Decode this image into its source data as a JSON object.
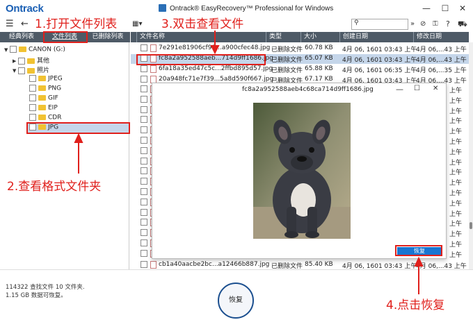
{
  "app": {
    "logo": "Ontrack",
    "title": "Ontrack® EasyRecovery™ Professional for Windows",
    "win_minimize": "—",
    "win_maximize": "☐",
    "win_close": "✕"
  },
  "toolbar": {
    "search_placeholder": "",
    "search_icon": "search-icon"
  },
  "left_tabs": [
    "经典列表",
    "文件列表",
    "已删除列表"
  ],
  "tree": {
    "drive": "CANON (G:)",
    "other": "其他",
    "photos": "照片",
    "formats": [
      "JPEG",
      "PNG",
      "GIF",
      "EIP",
      "CDR",
      "JPG"
    ]
  },
  "columns": [
    "文件名称",
    "类型",
    "大小",
    "创建日期",
    "修改日期"
  ],
  "files": [
    {
      "name": "7e291e81906cf99...a900cfec48.jpg",
      "type": "已删除文件",
      "size": "60.78 KB",
      "created": "4月 06, 1601 03:43 上午",
      "modified": "4月 06,...43 上午"
    },
    {
      "name": "fc8a2a952588aeb...714d9ff1686.jpg",
      "type": "已删除文件",
      "size": "65.07 KB",
      "created": "4月 06, 1601 03:43 上午",
      "modified": "4月 06,...43 上午"
    },
    {
      "name": "6fa18a35ed47c5c...2ffbd895d57.jpg",
      "type": "已删除文件",
      "size": "65.88 KB",
      "created": "4月 06, 1601 06:35 上午",
      "modified": "4月 06,...35 上午"
    },
    {
      "name": "20a948fc71e7f39...5a8d590f667.jpg",
      "type": "已删除文件",
      "size": "67.17 KB",
      "created": "4月 06, 1601 03:43 上午",
      "modified": "4月 06,...43 上午"
    },
    {
      "name": "cb1a40aacbe2bc...a12466b887.jpg",
      "type": "已删除文件",
      "size": "85.40 KB",
      "created": "4月 06, 1601 03:43 上午",
      "modified": "4月 06,...43 上午"
    }
  ],
  "partial_modified": [
    "上午",
    "上午",
    "上午",
    "上午",
    "上午",
    "上午",
    "上午",
    "上午",
    "上午",
    "上午",
    "上午",
    "上午",
    "上午",
    "上午",
    "上午",
    "上午",
    "上午"
  ],
  "preview": {
    "title": "fc8a2a952588aeb4c68ca714d9ff1686.jpg",
    "recover_label": "恢复"
  },
  "status": {
    "line1": "114322 查找文件 10 文件夹.",
    "line2": "1.15 GB 数据可恢复。"
  },
  "recover_button": "恢复",
  "annotations": {
    "step1": "1.打开文件列表",
    "step2": "2.查看格式文件夹",
    "step3": "3.双击查看文件",
    "step4": "4.点击恢复"
  }
}
